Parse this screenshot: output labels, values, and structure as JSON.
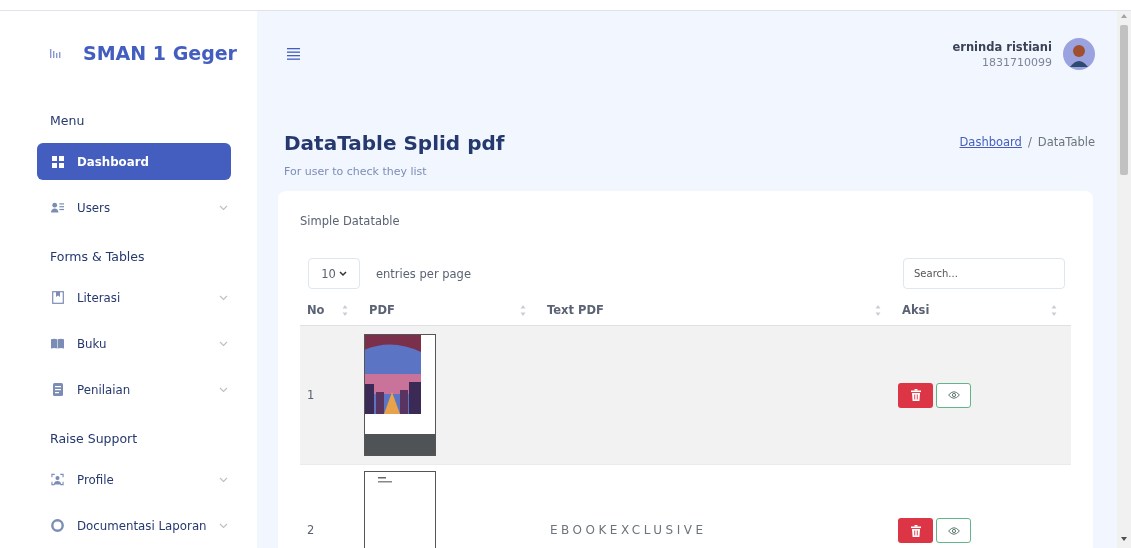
{
  "sidebar": {
    "brand": "SMAN 1 Geger",
    "items": [
      {
        "kind": "heading",
        "label": "Menu"
      },
      {
        "kind": "link",
        "label": "Dashboard",
        "selected": true,
        "expandable": false
      },
      {
        "kind": "link",
        "label": "Users",
        "selected": false,
        "expandable": true
      },
      {
        "kind": "heading",
        "label": "Forms & Tables"
      },
      {
        "kind": "link",
        "label": "Literasi",
        "selected": false,
        "expandable": true
      },
      {
        "kind": "link",
        "label": "Buku",
        "selected": false,
        "expandable": true
      },
      {
        "kind": "link",
        "label": "Penilaian",
        "selected": false,
        "expandable": true
      },
      {
        "kind": "heading",
        "label": "Raise Support"
      },
      {
        "kind": "link",
        "label": "Profile",
        "selected": false,
        "expandable": true
      },
      {
        "kind": "link",
        "label": "Documentasi Laporan",
        "selected": false,
        "expandable": true
      }
    ]
  },
  "header": {
    "user_name": "erninda ristiani",
    "user_id": "1831710099"
  },
  "page": {
    "title": "DataTable Splid pdf",
    "subtitle": "For user to check they list",
    "breadcrumb_separator": "/",
    "breadcrumb": [
      {
        "label": "Dashboard",
        "link": true
      },
      {
        "label": "DataTable",
        "link": false
      }
    ]
  },
  "card": {
    "title": "Simple Datatable",
    "per_page": "10",
    "per_page_label": "entries per page",
    "search": {
      "placeholder": "Search..."
    },
    "columns": [
      "No",
      "PDF",
      "Text PDF",
      "Aksi"
    ],
    "rows": [
      {
        "no": "1",
        "kind": "cover",
        "highlighted": true
      },
      {
        "no": "2",
        "kind": "page",
        "text": "EBOOKEXCLUSIVE",
        "highlighted": false
      }
    ]
  }
}
